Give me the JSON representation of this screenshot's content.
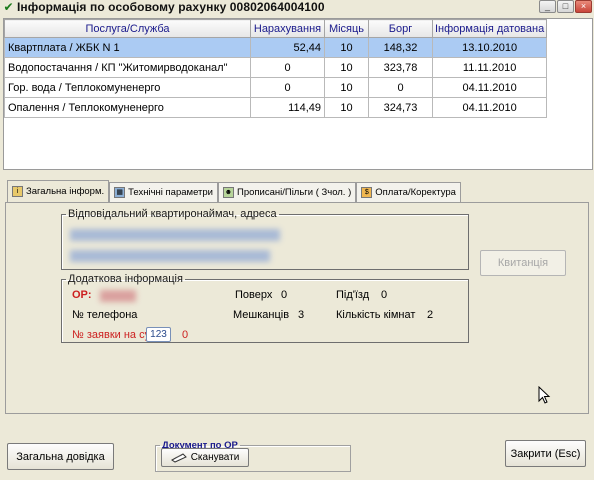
{
  "window": {
    "title": "Інформація по особовому рахунку  00802064004100",
    "controls": [
      "_",
      "□",
      "×"
    ]
  },
  "grid": {
    "columns": [
      "Послуга/Служба",
      "Нарахування",
      "Місяць",
      "Борг",
      "Інформація датована"
    ],
    "rows": [
      {
        "service": "Квартплата / ЖБК N 1",
        "charge": "52,44",
        "month": "10",
        "debt": "148,32",
        "date": "13.10.2010",
        "selected": true
      },
      {
        "service": "Водопостачання / КП \"Житомирводоканал\"",
        "charge": "0",
        "month": "10",
        "debt": "323,78",
        "date": "11.11.2010",
        "selected": false
      },
      {
        "service": "Гор. вода / Теплокомуненерго",
        "charge": "0",
        "month": "10",
        "debt": "0",
        "date": "04.11.2010",
        "selected": false
      },
      {
        "service": "Опалення / Теплокомуненерго",
        "charge": "114,49",
        "month": "10",
        "debt": "324,73",
        "date": "04.11.2010",
        "selected": false
      }
    ]
  },
  "tabs": [
    {
      "label": "Загальна інформ.",
      "icon": "info-icon",
      "active": true
    },
    {
      "label": "Технічні параметри",
      "icon": "tech-params-icon",
      "active": false
    },
    {
      "label": "Прописані/Пільги ( Зчол. )",
      "icon": "people-icon",
      "active": false
    },
    {
      "label": "Оплата/Коректура",
      "icon": "payment-icon",
      "active": false
    }
  ],
  "general": {
    "responsible_legend": "Відповідальний квартиронаймач, адреса",
    "receipt_button": "Квитанція",
    "additional_legend": "Додаткова інформація",
    "op_label": "OP:",
    "floors_label": "Поверх",
    "floors_value": "0",
    "entrance_label": "Під'їзд",
    "entrance_value": "0",
    "phone_label": "№ телефона",
    "residents_label": "Мешканців",
    "residents_value": "3",
    "rooms_label": "Кількість кімнат",
    "rooms_value": "2",
    "subsidy_label_prefix": "№ заявки на суб",
    "subsidy_badge": "123",
    "subsidy_value": "0"
  },
  "footer": {
    "general_help_button": "Загальна довідка",
    "document_group": "Документ по ОР",
    "scan_button": "Сканувати",
    "close_button": "Закрити (Esc)"
  },
  "colors": {
    "selected_row": "#abcbf3",
    "accent_red": "#cc1f1f",
    "header_text": "#1a1a8c"
  }
}
